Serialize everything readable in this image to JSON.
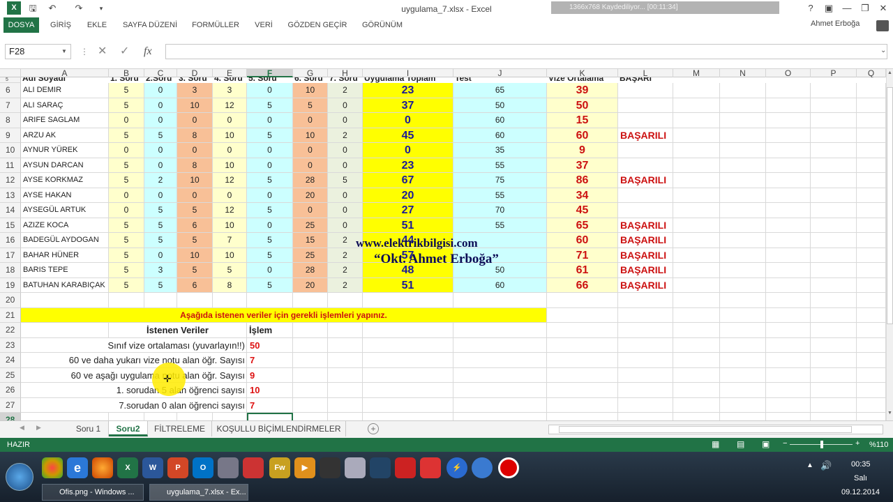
{
  "window": {
    "title": "uygulama_7.xlsx - Excel",
    "logo": "X",
    "record_text": "1366x768   Kaydediliyor...  [00:11:34]"
  },
  "ribbon": {
    "tabs": [
      "DOSYA",
      "GİRİŞ",
      "EKLE",
      "SAYFA DÜZENİ",
      "FORMÜLLER",
      "VERİ",
      "GÖZDEN GEÇİR",
      "GÖRÜNÜM"
    ],
    "user": "Ahmet Erboğa"
  },
  "formula_bar": {
    "cell_ref": "F28",
    "value": "",
    "fx": "fx"
  },
  "columns": [
    "A",
    "B",
    "C",
    "D",
    "E",
    "F",
    "G",
    "H",
    "I",
    "J",
    "K",
    "L",
    "M",
    "N",
    "O",
    "P",
    "Q"
  ],
  "header_row": {
    "A": "Adı Soyadı",
    "B": "1. Soru",
    "C": "2.Soru",
    "D": "3. Soru",
    "E": "4. Soru",
    "F": "5. Soru",
    "G": "6. Soru",
    "H": "7. Soru",
    "I": "Uygulama Toplam",
    "J": "Test",
    "K": "Vize Ortalama",
    "L": "BAŞARI"
  },
  "rows": [
    {
      "n": "6",
      "name": "ALI DEMIR",
      "v": [
        "5",
        "0",
        "3",
        "3",
        "0",
        "10",
        "2"
      ],
      "total": "23",
      "test": "65",
      "avg": "39",
      "status": ""
    },
    {
      "n": "7",
      "name": "ALI SARAÇ",
      "v": [
        "5",
        "0",
        "10",
        "12",
        "5",
        "5",
        "0"
      ],
      "total": "37",
      "test": "50",
      "avg": "50",
      "status": ""
    },
    {
      "n": "8",
      "name": "ARIFE SAGLAM",
      "v": [
        "0",
        "0",
        "0",
        "0",
        "0",
        "0",
        "0"
      ],
      "total": "0",
      "test": "60",
      "avg": "15",
      "status": ""
    },
    {
      "n": "9",
      "name": "ARZU AK",
      "v": [
        "5",
        "5",
        "8",
        "10",
        "5",
        "10",
        "2"
      ],
      "total": "45",
      "test": "60",
      "avg": "60",
      "status": "BAŞARILI"
    },
    {
      "n": "10",
      "name": "AYNUR YÜREK",
      "v": [
        "0",
        "0",
        "0",
        "0",
        "0",
        "0",
        "0"
      ],
      "total": "0",
      "test": "35",
      "avg": "9",
      "status": ""
    },
    {
      "n": "11",
      "name": "AYSUN DARCAN",
      "v": [
        "5",
        "0",
        "8",
        "10",
        "0",
        "0",
        "0"
      ],
      "total": "23",
      "test": "55",
      "avg": "37",
      "status": ""
    },
    {
      "n": "12",
      "name": "AYSE KORKMAZ",
      "v": [
        "5",
        "2",
        "10",
        "12",
        "5",
        "28",
        "5"
      ],
      "total": "67",
      "test": "75",
      "avg": "86",
      "status": "BAŞARILI"
    },
    {
      "n": "13",
      "name": "AYSE HAKAN",
      "v": [
        "0",
        "0",
        "0",
        "0",
        "0",
        "20",
        "0"
      ],
      "total": "20",
      "test": "55",
      "avg": "34",
      "status": ""
    },
    {
      "n": "14",
      "name": "AYSEGÜL ARTUK",
      "v": [
        "0",
        "5",
        "5",
        "12",
        "5",
        "0",
        "0"
      ],
      "total": "27",
      "test": "70",
      "avg": "45",
      "status": ""
    },
    {
      "n": "15",
      "name": "AZIZE KOCA",
      "v": [
        "5",
        "5",
        "6",
        "10",
        "0",
        "25",
        "0"
      ],
      "total": "51",
      "test": "55",
      "avg": "65",
      "status": "BAŞARILI"
    },
    {
      "n": "16",
      "name": "BADEGÜL AYDOGAN",
      "v": [
        "5",
        "5",
        "5",
        "7",
        "5",
        "15",
        "2"
      ],
      "total": "44",
      "test": "",
      "avg": "60",
      "status": "BAŞARILI"
    },
    {
      "n": "17",
      "name": "BAHAR HÜNER",
      "v": [
        "5",
        "0",
        "10",
        "10",
        "5",
        "25",
        "2"
      ],
      "total": "57",
      "test": "",
      "avg": "71",
      "status": "BAŞARILI"
    },
    {
      "n": "18",
      "name": "BARIS TEPE",
      "v": [
        "5",
        "3",
        "5",
        "5",
        "0",
        "28",
        "2"
      ],
      "total": "48",
      "test": "50",
      "avg": "61",
      "status": "BAŞARILI"
    },
    {
      "n": "19",
      "name": "BATUHAN KARABIÇAK",
      "v": [
        "5",
        "5",
        "6",
        "8",
        "5",
        "20",
        "2"
      ],
      "total": "51",
      "test": "60",
      "avg": "66",
      "status": "BAŞARILI"
    }
  ],
  "task": {
    "banner": "Aşağıda istenen veriler için gerekli işlemleri yapınız.",
    "col1_header": "İstenen Veriler",
    "col2_header": "İşlem",
    "items": [
      {
        "n": "23",
        "q": "Sınıf vize ortalaması (yuvarlayın!!)",
        "a": "50"
      },
      {
        "n": "24",
        "q": "60 ve daha yukarı vize notu alan öğr. Sayısı",
        "a": "7"
      },
      {
        "n": "25",
        "q": "60 ve aşağı uygulama notu alan öğr. Sayısı",
        "a": "9"
      },
      {
        "n": "26",
        "q": "1. sorudan 5 alan öğrenci sayısı",
        "a": "10"
      },
      {
        "n": "27",
        "q": "7.sorudan  0 alan öğrenci sayısı",
        "a": "7"
      }
    ]
  },
  "extra_rows": {
    "r20": "20",
    "r21": "21",
    "r22": "22",
    "r28": "28",
    "r5": "5"
  },
  "watermark": {
    "line1": "www.elektrikbilgisi.com",
    "line2": "“Okt. Ahmet Erboğa”"
  },
  "sheets": [
    "Soru 1",
    "Soru2",
    "FİLTRELEME",
    "KOŞULLU BİÇİMLENDİRMELER"
  ],
  "status": {
    "mode": "HAZIR",
    "zoom": "%110"
  },
  "taskbar": {
    "items": [
      "Ofis.png - Windows ...",
      "uygulama_7.xlsx - Ex..."
    ],
    "time": "00:35",
    "day": "Salı",
    "date": "09.12.2014"
  },
  "colors": {
    "excel_green": "#217346",
    "yellow": "#ffff00",
    "light_yellow": "#ffffcc",
    "cyan": "#ccffff",
    "orange": "#f8c097",
    "light_green": "#ebf1de"
  }
}
